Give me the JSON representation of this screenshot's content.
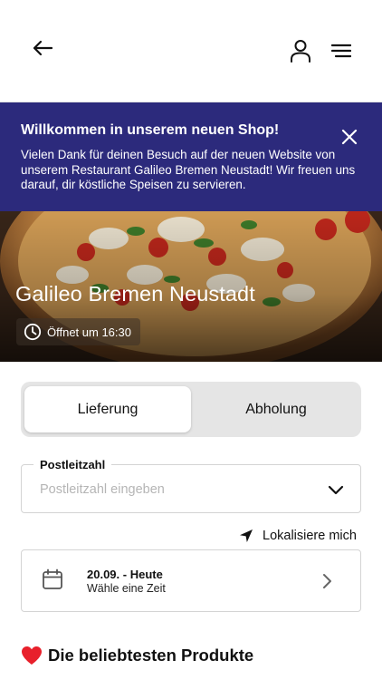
{
  "header": {
    "back_icon": "arrow-left-icon",
    "account_icon": "user-icon",
    "menu_icon": "hamburger-menu-icon"
  },
  "banner": {
    "title": "Willkommen in unserem neuen Shop!",
    "text": "Vielen Dank für deinen Besuch auf der neuen Website von unserem Restaurant Galileo Bremen Neustadt! Wir freuen uns darauf, dir köstliche Speisen zu servieren.",
    "close_icon": "close-icon",
    "background_color": "#2c2a7c"
  },
  "hero": {
    "restaurant_name": "Galileo Bremen Neustadt",
    "opening_text": "Öffnet um 16:30",
    "clock_icon": "clock-icon",
    "image": "pizza-photo"
  },
  "order_type": {
    "options": [
      {
        "label": "Lieferung",
        "selected": true
      },
      {
        "label": "Abholung",
        "selected": false
      }
    ]
  },
  "zip": {
    "label": "Postleitzahl",
    "placeholder": "Postleitzahl eingeben",
    "value": "",
    "chevron_icon": "chevron-down-icon"
  },
  "locate": {
    "label": "Lokalisiere mich",
    "icon": "location-arrow-icon"
  },
  "schedule": {
    "date": "20.09. - Heute",
    "prompt": "Wähle eine Zeit",
    "calendar_icon": "calendar-icon",
    "chevron_icon": "chevron-right-icon"
  },
  "popular": {
    "heading": "Die beliebtesten Produkte",
    "icon": "heart-icon",
    "icon_color": "#e8202b"
  }
}
